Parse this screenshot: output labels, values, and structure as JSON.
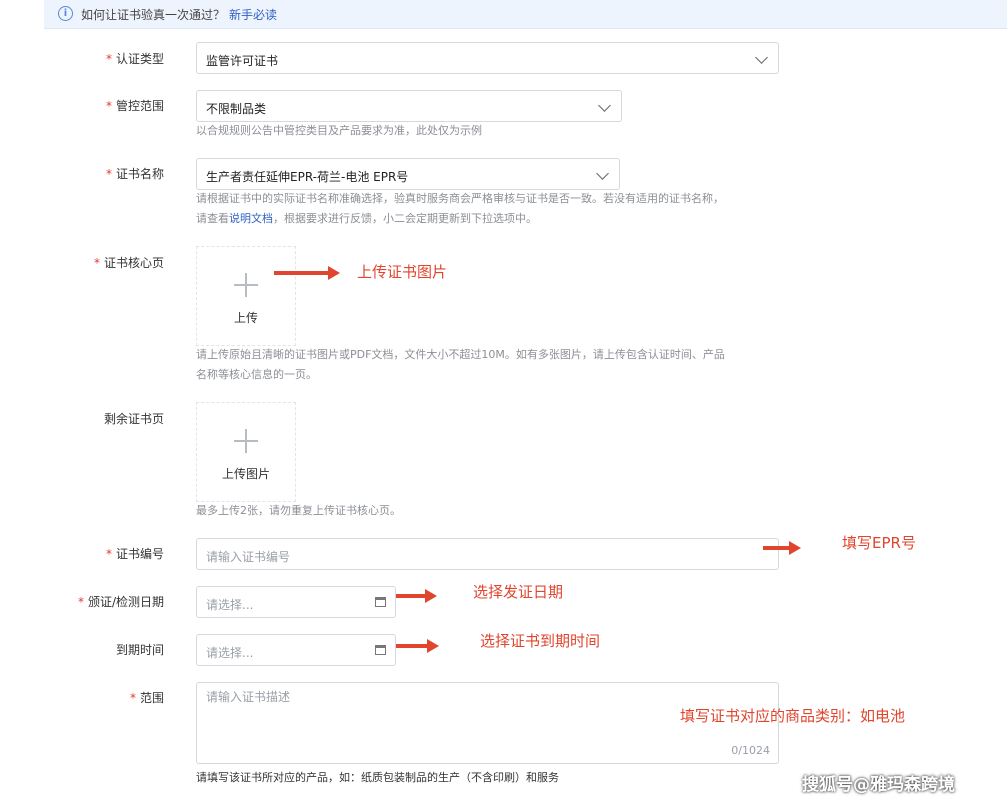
{
  "banner": {
    "text": "如何让证书验真一次通过？",
    "link": "新手必读"
  },
  "fields": {
    "cert_type": {
      "label": "认证类型",
      "value": "监管许可证书"
    },
    "control_scope": {
      "label": "管控范围",
      "value": "不限制品类",
      "help": "以合规规则公告中管控类目及产品要求为准，此处仅为示例"
    },
    "cert_name": {
      "label": "证书名称",
      "value": "生产者责任延伸EPR-荷兰-电池 EPR号",
      "help1": "请根据证书中的实际证书名称准确选择，验真时服务商会严格审核与证书是否一致。若没有适用的证书名称，",
      "help2_pre": "请查看",
      "help2_link": "说明文档",
      "help2_post": "，根据要求进行反馈，小二会定期更新到下拉选项中。"
    },
    "core_page": {
      "label": "证书核心页",
      "upload": "上传",
      "help1": "请上传原始且清晰的证书图片或PDF文档，文件大小不超过10M。如有多张图片，请上传包含认证时间、产品",
      "help2": "名称等核心信息的一页。"
    },
    "other_pages": {
      "label": "剩余证书页",
      "upload": "上传图片",
      "help": "最多上传2张，请勿重复上传证书核心页。"
    },
    "cert_no": {
      "label": "证书编号",
      "placeholder": "请输入证书编号"
    },
    "issue_date": {
      "label": "颁证/检测日期",
      "placeholder": "请选择..."
    },
    "expiry": {
      "label": "到期时间",
      "placeholder": "请选择..."
    },
    "scope": {
      "label": "范围",
      "placeholder": "请输入证书描述",
      "counter": "0/1024",
      "help": "请填写该证书所对应的产品，如：纸质包装制品的生产（不含印刷）和服务"
    }
  },
  "annotations": {
    "upload": "上传证书图片",
    "epr": "填写EPR号",
    "issue": "选择发证日期",
    "expiry": "选择证书到期时间",
    "scope": "填写证书对应的商品类别：如电池"
  },
  "watermark": "搜狐号@雅玛森跨境",
  "required_mark": "*",
  "colors": {
    "accent": "#2f5fc4",
    "required": "#e23b2f",
    "annotation": "#e0452d"
  }
}
